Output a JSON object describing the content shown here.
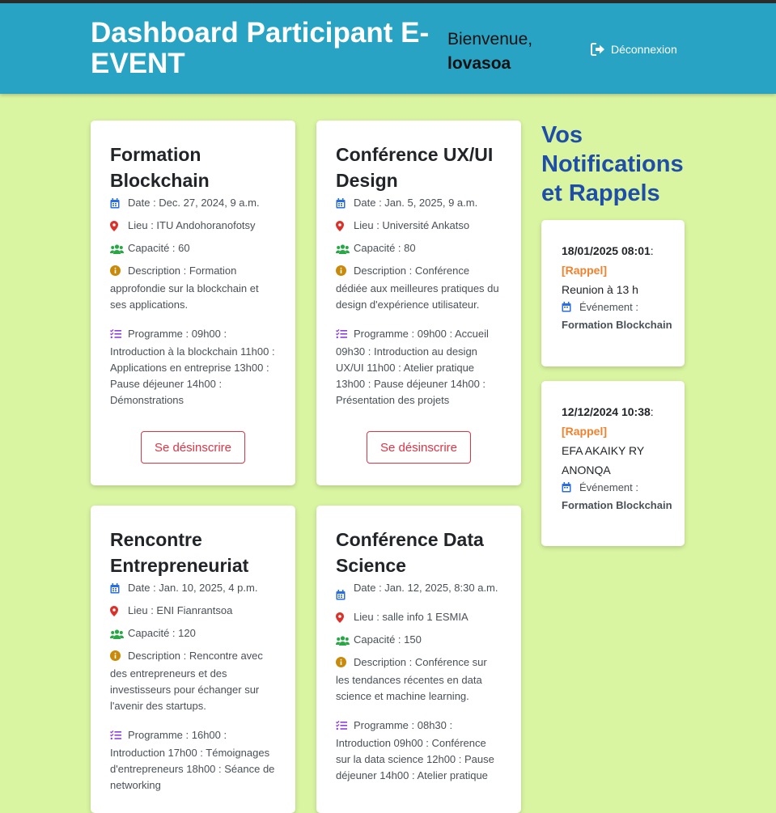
{
  "header": {
    "title": "Dashboard Participant E-EVENT",
    "welcome": "Bienvenue,",
    "username": "lovasoa",
    "logout_label": "Déconnexion"
  },
  "events": [
    {
      "title": "Formation Blockchain",
      "date": "Date : Dec. 27, 2024, 9 a.m.",
      "lieu": "Lieu : ITU Andohoranofotsy",
      "capacite": "Capacité : 60",
      "description": "Description : Formation approfondie sur la blockchain et ses applications.",
      "programme": "Programme : 09h00 : Introduction à la blockchain 11h00 : Applications en entreprise 13h00 : Pause déjeuner 14h00 : Démonstrations",
      "button": "Se désinscrire"
    },
    {
      "title": "Conférence UX/UI Design",
      "date": "Date : Jan. 5, 2025, 9 a.m.",
      "lieu": "Lieu : Université Ankatso",
      "capacite": "Capacité : 80",
      "description": "Description : Conférence dédiée aux meilleures pratiques du design d'expérience utilisateur.",
      "programme": "Programme : 09h00 : Accueil 09h30 : Introduction au design UX/UI 11h00 : Atelier pratique 13h00 : Pause déjeuner 14h00 : Présentation des projets",
      "button": "Se désinscrire"
    },
    {
      "title": "Rencontre Entrepreneuriat",
      "date": "Date : Jan. 10, 2025, 4 p.m.",
      "lieu": "Lieu : ENI Fianrantsoa",
      "capacite": "Capacité : 120",
      "description": "Description : Rencontre avec des entrepreneurs et des investisseurs pour échanger sur l'avenir des startups.",
      "programme": "Programme : 16h00 : Introduction 17h00 : Témoignages d'entrepreneurs 18h00 : Séance de networking"
    },
    {
      "title": "Conférence Data Science",
      "date": "Date : Jan. 12, 2025, 8:30 a.m.",
      "lieu": "Lieu : salle info 1 ESMIA",
      "capacite": "Capacité : 150",
      "description": "Description : Conférence sur les tendances récentes en data science et machine learning.",
      "programme": "Programme : 08h30 : Introduction 09h00 : Conférence sur la data science 12h00 : Pause déjeuner 14h00 : Atelier pratique"
    }
  ],
  "notifications": {
    "heading": "Vos Notifications et Rappels",
    "items": [
      {
        "date": "18/01/2025 08:01",
        "tag": "[Rappel]",
        "message": "Reunion à 13 h",
        "event_label": "Événement :",
        "event_name": "Formation Blockchain"
      },
      {
        "date": "12/12/2024 10:38",
        "tag": "[Rappel]",
        "message": "EFA AKAIKY RY ANONQA",
        "event_label": "Événement :",
        "event_name": "Formation Blockchain"
      }
    ]
  },
  "colors": {
    "page_bg": "#d9f5a1",
    "header_bg": "#29a3c3",
    "notif_heading": "#1f4ea8",
    "rappel": "#f0812d",
    "unsubscribe": "#dc3545"
  }
}
